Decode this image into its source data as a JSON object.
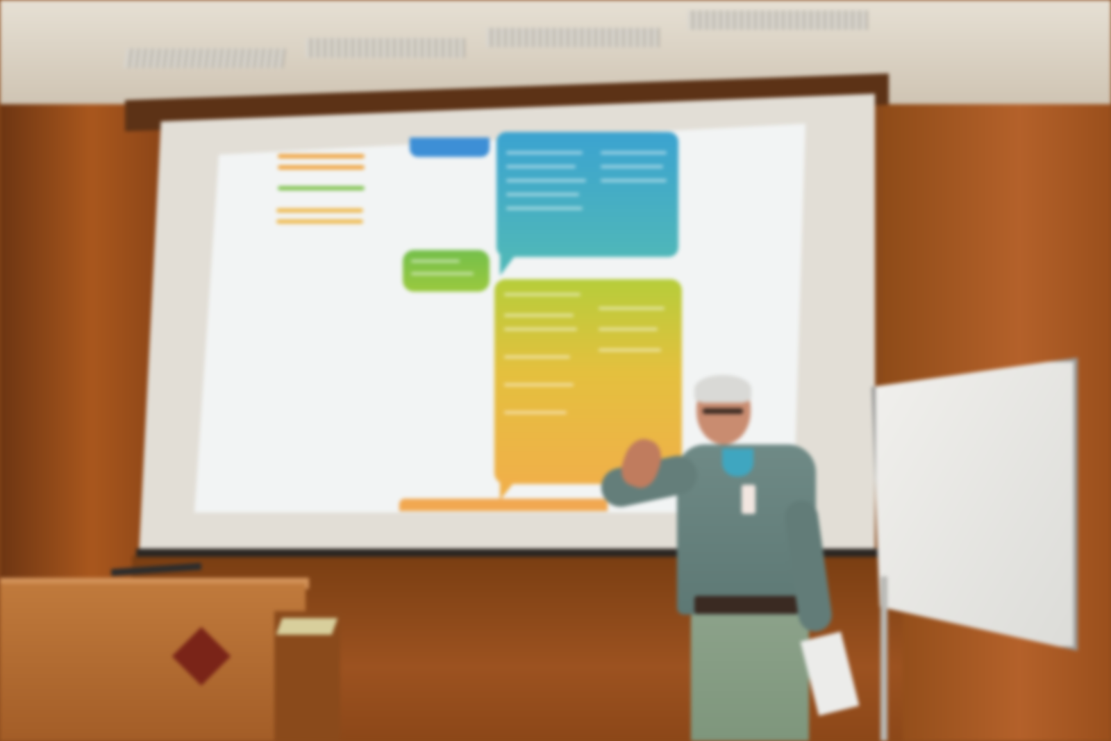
{
  "scene": {
    "description_free": true,
    "colors": {
      "wall": "#a9571d",
      "screen": "#e2ded6",
      "slide_background": "#f2f4f4",
      "slide_blue": "#3d8fd6",
      "slide_teal": "#3ba3d0",
      "slide_green": "#74bf4a",
      "slide_yellow": "#e4c03e",
      "slide_orange": "#f0b049",
      "lectern": "#c07a3c",
      "whiteboard": "#f1f0ed"
    }
  }
}
